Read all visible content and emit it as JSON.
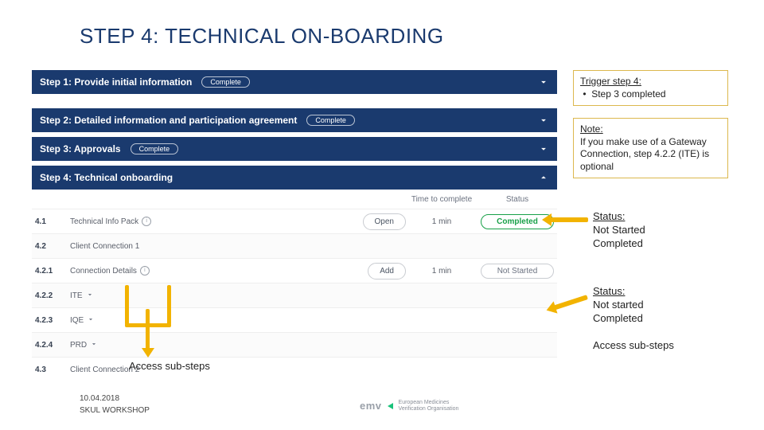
{
  "title": "STEP 4: TECHNICAL ON-BOARDING",
  "steps": {
    "s1": {
      "label": "Step 1: Provide initial information",
      "badge": "Complete"
    },
    "s2": {
      "label": "Step 2: Detailed information and participation agreement",
      "badge": "Complete"
    },
    "s3": {
      "label": "Step 3: Approvals",
      "badge": "Complete"
    },
    "s4": {
      "label": "Step 4: Technical onboarding"
    }
  },
  "cols": {
    "time": "Time to complete",
    "status": "Status"
  },
  "rows": {
    "r41": {
      "num": "4.1",
      "name": "Technical Info Pack",
      "btn": "Open",
      "time": "1 min",
      "status": "Completed"
    },
    "r42": {
      "num": "4.2",
      "name": "Client Connection 1"
    },
    "r421": {
      "num": "4.2.1",
      "name": "Connection Details",
      "btn": "Add",
      "time": "1 min",
      "status": "Not Started"
    },
    "r422": {
      "num": "4.2.2",
      "name": "ITE"
    },
    "r423": {
      "num": "4.2.3",
      "name": "IQE"
    },
    "r424": {
      "num": "4.2.4",
      "name": "PRD"
    },
    "r43": {
      "num": "4.3",
      "name": "Client Connection 2"
    }
  },
  "annot": {
    "trigger_h": "Trigger step 4:",
    "trigger_b": "Step 3 completed",
    "note_h": "Note:",
    "note_b": "If you make use of a Gateway Connection, step 4.2.2 (ITE) is optional"
  },
  "side": {
    "s1_h": "Status:",
    "s1_l1": "Not Started",
    "s1_l2": "Completed",
    "s2_h": "Status:",
    "s2_l1": "Not started",
    "s2_l2": "Completed",
    "access": "Access sub-steps"
  },
  "sub_label": "Access sub-steps",
  "footer": {
    "date": "10.04.2018",
    "workshop": "SKUL WORKSHOP"
  },
  "logo": {
    "mark": "emv",
    "line1": "European Medicines",
    "line2": "Verification Organisation"
  },
  "icons": {
    "info": "i"
  }
}
